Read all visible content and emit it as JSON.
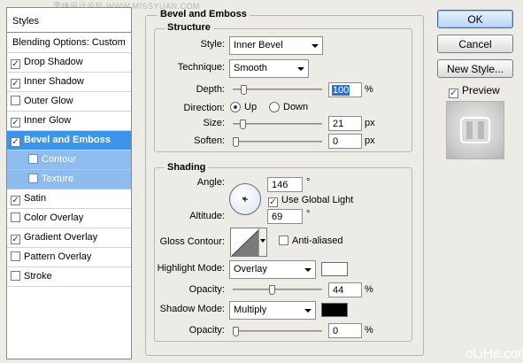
{
  "watermark_top": "思缘设计论坛 WWW.MISSYUAN.COM",
  "watermark_bottom": "oLiHe.com",
  "styles_list": {
    "header": "Styles",
    "blending_options": "Blending Options: Custom",
    "items": [
      {
        "label": "Drop Shadow",
        "checked": true
      },
      {
        "label": "Inner Shadow",
        "checked": true
      },
      {
        "label": "Outer Glow",
        "checked": false
      },
      {
        "label": "Inner Glow",
        "checked": true
      },
      {
        "label": "Bevel and Emboss",
        "checked": true,
        "selected": true
      },
      {
        "label": "Contour",
        "checked": false,
        "sub": true
      },
      {
        "label": "Texture",
        "checked": false,
        "sub": true
      },
      {
        "label": "Satin",
        "checked": true
      },
      {
        "label": "Color Overlay",
        "checked": false
      },
      {
        "label": "Gradient Overlay",
        "checked": true
      },
      {
        "label": "Pattern Overlay",
        "checked": false
      },
      {
        "label": "Stroke",
        "checked": false
      }
    ]
  },
  "bevel_emboss": {
    "title": "Bevel and Emboss",
    "structure": {
      "title": "Structure",
      "style_label": "Style:",
      "style_value": "Inner Bevel",
      "technique_label": "Technique:",
      "technique_value": "Smooth",
      "depth_label": "Depth:",
      "depth_value": "100",
      "depth_unit": "%",
      "depth_level": 0.1,
      "direction_label": "Direction:",
      "direction_up": "Up",
      "direction_down": "Down",
      "direction_selected": "Up",
      "size_label": "Size:",
      "size_value": "21",
      "size_unit": "px",
      "size_level": 0.08,
      "soften_label": "Soften:",
      "soften_value": "0",
      "soften_unit": "px",
      "soften_level": 0.0
    },
    "shading": {
      "title": "Shading",
      "angle_label": "Angle:",
      "angle_value": "146",
      "angle_unit": "°",
      "use_global_light_label": "Use Global Light",
      "use_global_light_checked": true,
      "altitude_label": "Altitude:",
      "altitude_value": "69",
      "altitude_unit": "°",
      "gloss_contour_label": "Gloss Contour:",
      "anti_aliased_label": "Anti-aliased",
      "anti_aliased_checked": false,
      "highlight_mode_label": "Highlight Mode:",
      "highlight_mode_value": "Overlay",
      "highlight_color": "#ffffff",
      "highlight_opacity_label": "Opacity:",
      "highlight_opacity_value": "44",
      "highlight_opacity_unit": "%",
      "highlight_opacity_level": 0.44,
      "shadow_mode_label": "Shadow Mode:",
      "shadow_mode_value": "Multiply",
      "shadow_color": "#000000",
      "shadow_opacity_label": "Opacity:",
      "shadow_opacity_value": "0",
      "shadow_opacity_unit": "%",
      "shadow_opacity_level": 0.0
    }
  },
  "buttons": {
    "ok": "OK",
    "cancel": "Cancel",
    "new_style": "New Style...",
    "preview_label": "Preview",
    "preview_checked": true
  },
  "colors": {
    "selection_blue": "#3d95ea",
    "sub_item_blue": "#8fbcef",
    "dialog_bg": "#ecebe6"
  }
}
